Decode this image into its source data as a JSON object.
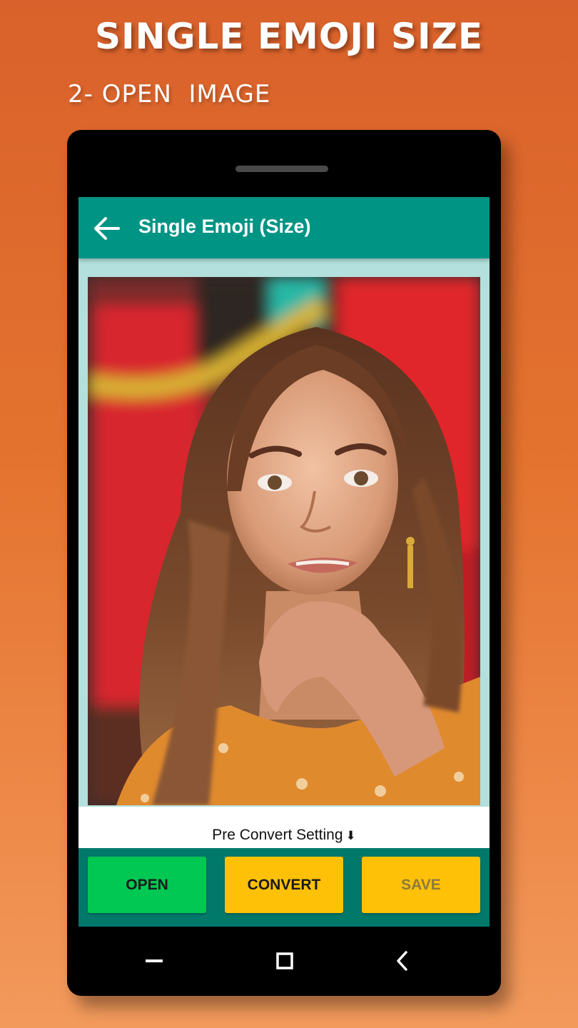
{
  "promo": {
    "headline": "SINGLE EMOJI SIZE",
    "step": "2- OPEN  IMAGE"
  },
  "app": {
    "title": "Single Emoji (Size)",
    "back_icon": "arrow-left-icon",
    "pre_convert_label": "Pre Convert Setting",
    "pre_convert_icon": "arrow-down-icon"
  },
  "buttons": {
    "open": "OPEN",
    "convert": "CONVERT",
    "save": "SAVE"
  },
  "navbar": {
    "recents_icon": "menu-bar-icon",
    "home_icon": "square-home-icon",
    "back_icon": "chevron-left-icon"
  },
  "colors": {
    "appbar": "#009485",
    "image_area": "#b3e0dc",
    "button_panel": "#00796b",
    "open_button": "#00c853",
    "convert_button": "#ffc107",
    "save_button": "#ffc107",
    "background_top": "#d9612b",
    "background_bottom": "#f29a5c"
  }
}
